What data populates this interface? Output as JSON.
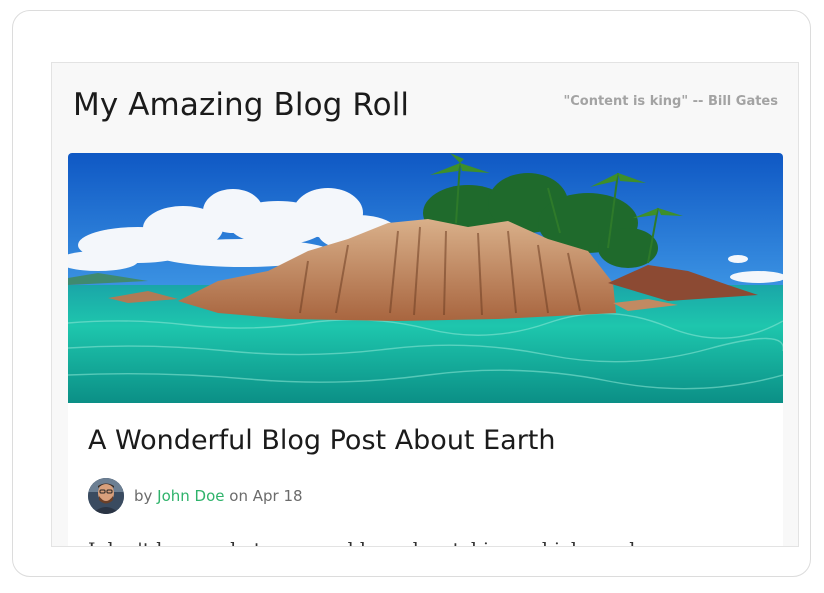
{
  "header": {
    "title": "My Amazing Blog Roll",
    "quote": "\"Content is king\" -- Bill Gates"
  },
  "post": {
    "title": "A Wonderful Blog Post About Earth",
    "by": "by ",
    "author": "John Doe",
    "on": " on ",
    "date": "Apr 18",
    "excerpt": "I don't know what you would need watching, which can be"
  },
  "colors": {
    "accent": "#2fb36b",
    "sky": "#1f6fd0",
    "water": "#17b9a6"
  }
}
